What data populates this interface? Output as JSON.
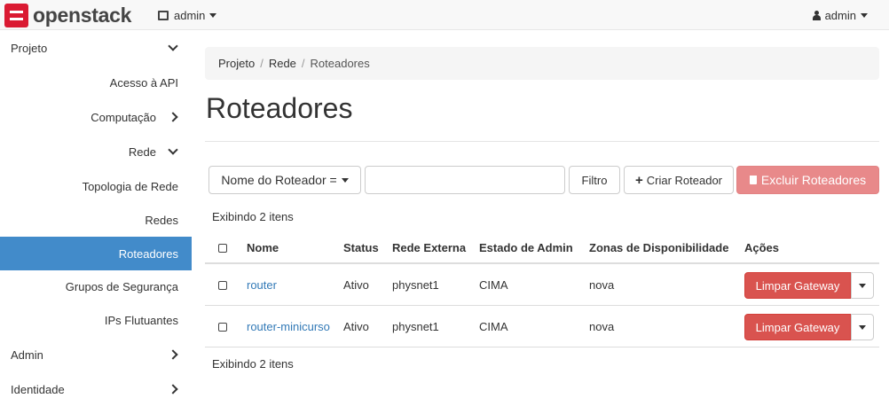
{
  "header": {
    "brand": "openstack",
    "project": "admin",
    "user": "admin"
  },
  "sidebar": {
    "items": [
      {
        "label": "Projeto"
      },
      {
        "label": "Acesso à API"
      },
      {
        "label": "Computação"
      },
      {
        "label": "Rede"
      },
      {
        "label": "Topologia de Rede"
      },
      {
        "label": "Redes"
      },
      {
        "label": "Roteadores"
      },
      {
        "label": "Grupos de Segurança"
      },
      {
        "label": "IPs Flutuantes"
      },
      {
        "label": "Admin"
      },
      {
        "label": "Identidade"
      }
    ]
  },
  "breadcrumb": [
    "Projeto",
    "Rede",
    "Roteadores"
  ],
  "page": {
    "title": "Roteadores"
  },
  "toolbar": {
    "filter_select": "Nome do Roteador =",
    "filter_value": "",
    "filter_button": "Filtro",
    "create_button": "Criar Roteador",
    "delete_button": "Excluir Roteadores"
  },
  "table": {
    "count_top": "Exibindo 2 itens",
    "count_bottom": "Exibindo 2 itens",
    "columns": [
      "Nome",
      "Status",
      "Rede Externa",
      "Estado de Admin",
      "Zonas de Disponibilidade",
      "Ações"
    ],
    "rows": [
      {
        "name": "router",
        "status": "Ativo",
        "network": "physnet1",
        "admin_state": "CIMA",
        "zone": "nova",
        "action": "Limpar Gateway"
      },
      {
        "name": "router-minicurso",
        "status": "Ativo",
        "network": "physnet1",
        "admin_state": "CIMA",
        "zone": "nova",
        "action": "Limpar Gateway"
      }
    ]
  },
  "colors": {
    "active": "#428bca",
    "danger": "#d9534f",
    "link": "#337ab7",
    "brand": "#da1a32"
  }
}
